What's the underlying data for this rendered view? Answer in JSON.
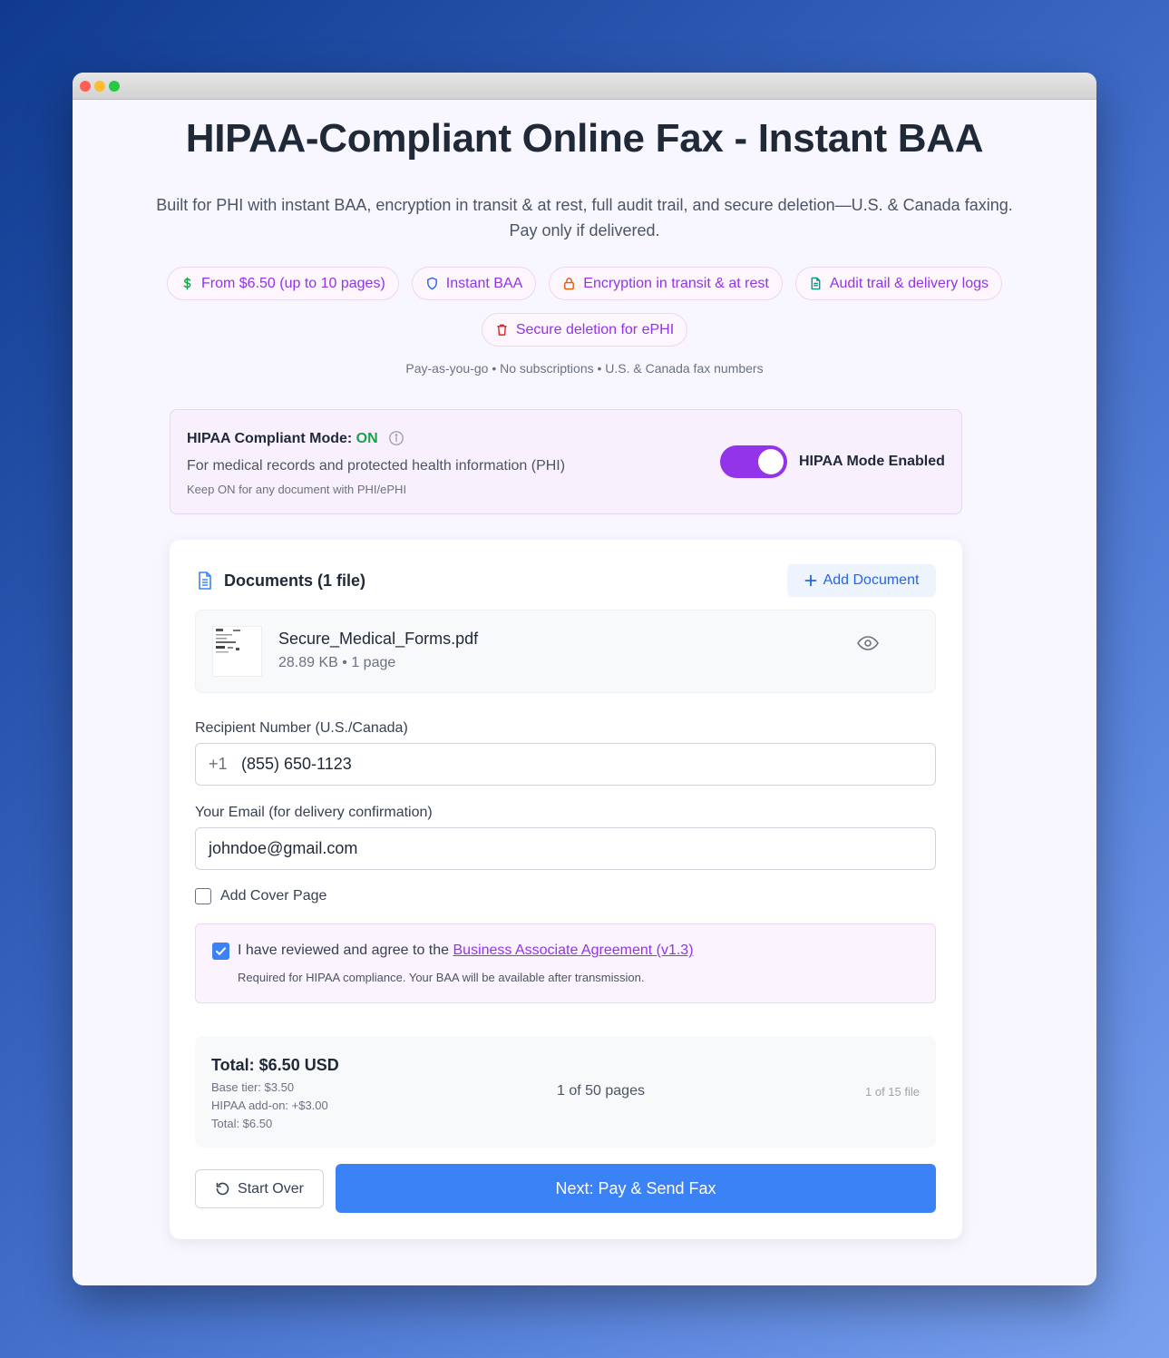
{
  "header": {
    "title": "HIPAA-Compliant Online Fax - Instant BAA",
    "subtitle_line1": "Built for PHI with instant BAA, encryption in transit & at rest, full audit trail, and secure deletion—U.S. & Canada faxing.",
    "subtitle_line2": "Pay only if delivered."
  },
  "badges": [
    {
      "label": "From $6.50 (up to 10 pages)",
      "icon": "dollar-icon",
      "color": "#16a34a"
    },
    {
      "label": "Instant BAA",
      "icon": "shield-icon",
      "color": "#2563eb"
    },
    {
      "label": "Encryption in transit & at rest",
      "icon": "lock-icon",
      "color": "#ea580c"
    },
    {
      "label": "Audit trail & delivery logs",
      "icon": "document-icon",
      "color": "#0d9488"
    },
    {
      "label": "Secure deletion for ePHI",
      "icon": "trash-icon",
      "color": "#dc2626"
    }
  ],
  "note": "Pay-as-you-go • No subscriptions • U.S. & Canada fax numbers",
  "hipaa": {
    "title": "HIPAA Compliant Mode:",
    "status": "ON",
    "description": "For medical records and protected health information (PHI)",
    "hint": "Keep ON for any document with PHI/ePHI",
    "toggle_label": "HIPAA Mode Enabled",
    "enabled": true
  },
  "documents": {
    "heading": "Documents (1 file)",
    "add_label": "Add Document",
    "file": {
      "name": "Secure_Medical_Forms.pdf",
      "meta": "28.89 KB • 1 page"
    }
  },
  "form": {
    "recipient_label": "Recipient Number (U.S./Canada)",
    "recipient_prefix": "+1",
    "recipient_value": "(855) 650-1123",
    "email_label": "Your Email (for delivery confirmation)",
    "email_value": "johndoe@gmail.com",
    "cover_label": "Add Cover Page",
    "agree_text": "I have reviewed and agree to the",
    "agree_link": "Business Associate Agreement (v1.3)",
    "agree_note": "Required for HIPAA compliance. Your BAA will be available after transmission."
  },
  "summary": {
    "total": "Total: $6.50 USD",
    "base": "Base tier: $3.50",
    "addon": "HIPAA add-on: +$3.00",
    "total_small": "Total: $6.50",
    "pages": "1 of 50 pages",
    "files": "1 of 15 file"
  },
  "actions": {
    "start_over": "Start Over",
    "next": "Next: Pay & Send Fax"
  },
  "colors": {
    "accent_purple": "#9333ea",
    "accent_blue": "#3b82f6",
    "status_green": "#16a34a"
  }
}
